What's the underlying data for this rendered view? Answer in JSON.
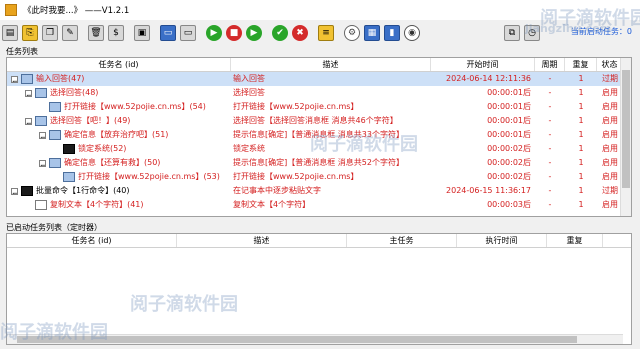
{
  "window": {
    "title": "《此时我要...》    ——V1.2.1"
  },
  "toolbar": {
    "buttons": [
      {
        "name": "new-task-icon",
        "style": "gray",
        "glyph": "▤"
      },
      {
        "name": "paste-task-icon",
        "style": "yellow",
        "glyph": "⎘"
      },
      {
        "name": "copy-task-icon",
        "style": "gray",
        "glyph": "❐"
      },
      {
        "name": "edit-task-icon",
        "style": "gray",
        "glyph": "✎"
      },
      {
        "name": "sep"
      },
      {
        "name": "delete-task-icon",
        "style": "gray",
        "glyph": "🗑"
      },
      {
        "name": "currency-icon",
        "style": "gray",
        "glyph": "$"
      },
      {
        "name": "sep"
      },
      {
        "name": "save-icon",
        "style": "gray",
        "glyph": "▣"
      },
      {
        "name": "sep"
      },
      {
        "name": "window-mode-icon",
        "style": "blue",
        "glyph": "▭"
      },
      {
        "name": "panel-mode-icon",
        "style": "gray",
        "glyph": "▭"
      },
      {
        "name": "sep"
      },
      {
        "name": "start-icon",
        "style": "green",
        "glyph": "▶"
      },
      {
        "name": "stop-icon",
        "style": "red",
        "glyph": "■"
      },
      {
        "name": "run-once-icon",
        "style": "green",
        "glyph": "▶"
      },
      {
        "name": "sep"
      },
      {
        "name": "enable-icon",
        "style": "green",
        "glyph": "✔"
      },
      {
        "name": "disable-icon",
        "style": "red",
        "glyph": "✖"
      },
      {
        "name": "sep"
      },
      {
        "name": "notes-icon",
        "style": "yellow",
        "glyph": "≡"
      },
      {
        "name": "sep"
      },
      {
        "name": "settings-gear-icon",
        "style": "gear",
        "glyph": "⚙"
      },
      {
        "name": "screen-icon",
        "style": "blue",
        "glyph": "▦"
      },
      {
        "name": "book-icon",
        "style": "blue",
        "glyph": "▮"
      },
      {
        "name": "view-eye-icon",
        "style": "eye",
        "glyph": "◉"
      },
      {
        "name": "spacer"
      },
      {
        "name": "lock-window-icon",
        "style": "gray",
        "glyph": "⧉"
      },
      {
        "name": "timer-icon",
        "style": "gray",
        "glyph": "◷"
      }
    ],
    "status_label": "当前启动任务：0"
  },
  "task_list": {
    "section_title": "任务列表",
    "columns": {
      "name": "任务名 (id)",
      "desc": "描述",
      "time": "开始时间",
      "period": "周期",
      "repeat": "重复",
      "state": "状态"
    },
    "rows": [
      {
        "indent": 0,
        "toggle": "⊟",
        "icon": "folder",
        "name": "输入回答(47)",
        "desc": "输入回答",
        "time": "2024-06-14 12:11:36",
        "period": "-",
        "repeat": "1",
        "state": "过期",
        "color": "red",
        "desc_color": "red",
        "time_color": "red",
        "state_color": "red",
        "sel": true
      },
      {
        "indent": 1,
        "toggle": "⊟",
        "icon": "folder",
        "name": "选择回答(48)",
        "desc": "选择回答",
        "time": "00:00:01后",
        "period": "-",
        "repeat": "1",
        "state": "启用",
        "color": "red",
        "desc_color": "red",
        "time_color": "red",
        "state_color": "red",
        "sel": false
      },
      {
        "indent": 2,
        "toggle": "",
        "icon": "folder",
        "name": "打开链接【www.52pojie.cn.ms】(54)",
        "desc": "打开链接【www.52pojie.cn.ms】",
        "time": "00:00:01后",
        "period": "-",
        "repeat": "1",
        "state": "启用",
        "color": "red",
        "desc_color": "red",
        "time_color": "red",
        "state_color": "red",
        "sel": false
      },
      {
        "indent": 1,
        "toggle": "⊟",
        "icon": "folder",
        "name": "选择回答【吧！】(49)",
        "desc": "选择回答【选择回答消息框 消息共46个字符】",
        "time": "00:00:01后",
        "period": "-",
        "repeat": "1",
        "state": "启用",
        "color": "red",
        "desc_color": "red",
        "time_color": "red",
        "state_color": "red",
        "sel": false
      },
      {
        "indent": 2,
        "toggle": "⊟",
        "icon": "folder",
        "name": "确定信息【放弃治疗吧】(51)",
        "desc": "提示信息[确定]【普通消息框 消息共33个字符】",
        "time": "00:00:01后",
        "period": "-",
        "repeat": "1",
        "state": "启用",
        "color": "red",
        "desc_color": "red",
        "time_color": "red",
        "state_color": "red",
        "sel": false
      },
      {
        "indent": 3,
        "toggle": "",
        "icon": "mon",
        "name": "锁定系统(52)",
        "desc": "锁定系统",
        "time": "00:00:02后",
        "period": "-",
        "repeat": "1",
        "state": "启用",
        "color": "red",
        "desc_color": "red",
        "time_color": "red",
        "state_color": "red",
        "sel": false
      },
      {
        "indent": 2,
        "toggle": "⊟",
        "icon": "folder",
        "name": "确定信息【还算有救】(50)",
        "desc": "提示信息[确定]【普通消息框 消息共52个字符】",
        "time": "00:00:02后",
        "period": "-",
        "repeat": "1",
        "state": "启用",
        "color": "red",
        "desc_color": "red",
        "time_color": "red",
        "state_color": "red",
        "sel": false
      },
      {
        "indent": 3,
        "toggle": "",
        "icon": "folder",
        "name": "打开链接【www.52pojie.cn.ms】(53)",
        "desc": "打开链接【www.52pojie.cn.ms】",
        "time": "00:00:02后",
        "period": "-",
        "repeat": "1",
        "state": "启用",
        "color": "red",
        "desc_color": "red",
        "time_color": "red",
        "state_color": "red",
        "sel": false
      },
      {
        "indent": 0,
        "toggle": "⊟",
        "icon": "mon",
        "name": "批量命令【1行命令】(40)",
        "desc": "在记事本中逐步粘贴文字",
        "time": "2024-06-15 11:36:17",
        "period": "-",
        "repeat": "1",
        "state": "过期",
        "color": "blk",
        "desc_color": "red",
        "time_color": "red",
        "state_color": "red",
        "sel": false
      },
      {
        "indent": 1,
        "toggle": "",
        "icon": "doc",
        "name": "复制文本【4个字符】(41)",
        "desc": "复制文本【4个字符】",
        "time": "00:00:03后",
        "period": "-",
        "repeat": "1",
        "state": "启用",
        "color": "red",
        "desc_color": "red",
        "time_color": "red",
        "state_color": "red",
        "sel": false
      }
    ]
  },
  "started_list": {
    "section_title": "已启动任务列表（定时器）",
    "columns": {
      "name": "任务名 (id)",
      "desc": "描述",
      "main": "主任务",
      "exec": "执行时间",
      "repeat": "重复"
    }
  },
  "watermarks": [
    "阅子滴软件园",
    "jiangzihu.com"
  ]
}
